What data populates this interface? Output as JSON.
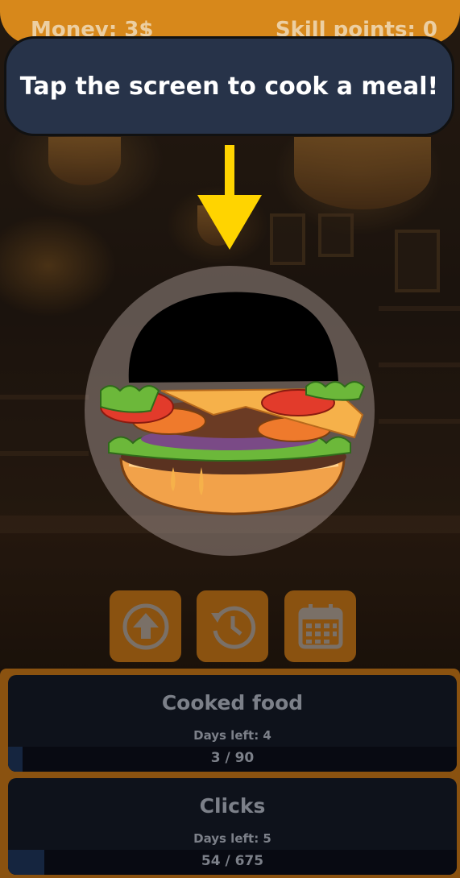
{
  "hud": {
    "money": "Money: 3$",
    "skill_points": "Skill points: 0"
  },
  "banner": {
    "text": "Tap the screen to cook a meal!"
  },
  "actions": [
    {
      "icon": "upgrade-arrow-icon"
    },
    {
      "icon": "history-clock-icon"
    },
    {
      "icon": "calendar-icon"
    }
  ],
  "quests": [
    {
      "title": "Cooked food",
      "days_left": "Days left: 4",
      "progress": "3 / 90",
      "fraction": 0.033
    },
    {
      "title": "Clicks",
      "days_left": "Days left: 5",
      "progress": "54 / 675",
      "fraction": 0.08
    }
  ],
  "colors": {
    "accent": "#d7881b",
    "banner": "#273349",
    "arrow": "#ffd400",
    "panel": "#8a5210"
  }
}
